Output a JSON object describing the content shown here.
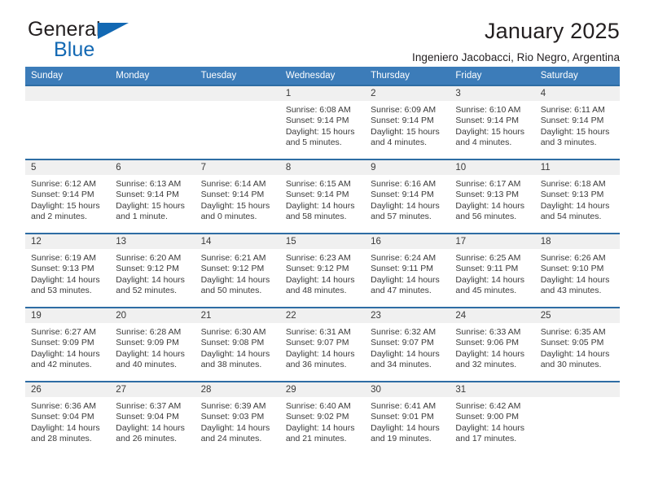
{
  "brand": {
    "line1": "General",
    "line2": "Blue",
    "triangle_color": "#1268b3"
  },
  "header": {
    "title": "January 2025",
    "subtitle": "Ingeniero Jacobacci, Rio Negro, Argentina",
    "accent_color": "#3c7cb9",
    "row_border_color": "#2e6da4",
    "daynum_bg": "#f0f0f0"
  },
  "weekday_headers": [
    "Sunday",
    "Monday",
    "Tuesday",
    "Wednesday",
    "Thursday",
    "Friday",
    "Saturday"
  ],
  "weeks": [
    [
      {
        "day": "",
        "empty": true
      },
      {
        "day": "",
        "empty": true
      },
      {
        "day": "",
        "empty": true
      },
      {
        "day": "1",
        "sunrise": "Sunrise: 6:08 AM",
        "sunset": "Sunset: 9:14 PM",
        "daylight": "Daylight: 15 hours and 5 minutes."
      },
      {
        "day": "2",
        "sunrise": "Sunrise: 6:09 AM",
        "sunset": "Sunset: 9:14 PM",
        "daylight": "Daylight: 15 hours and 4 minutes."
      },
      {
        "day": "3",
        "sunrise": "Sunrise: 6:10 AM",
        "sunset": "Sunset: 9:14 PM",
        "daylight": "Daylight: 15 hours and 4 minutes."
      },
      {
        "day": "4",
        "sunrise": "Sunrise: 6:11 AM",
        "sunset": "Sunset: 9:14 PM",
        "daylight": "Daylight: 15 hours and 3 minutes."
      }
    ],
    [
      {
        "day": "5",
        "sunrise": "Sunrise: 6:12 AM",
        "sunset": "Sunset: 9:14 PM",
        "daylight": "Daylight: 15 hours and 2 minutes."
      },
      {
        "day": "6",
        "sunrise": "Sunrise: 6:13 AM",
        "sunset": "Sunset: 9:14 PM",
        "daylight": "Daylight: 15 hours and 1 minute."
      },
      {
        "day": "7",
        "sunrise": "Sunrise: 6:14 AM",
        "sunset": "Sunset: 9:14 PM",
        "daylight": "Daylight: 15 hours and 0 minutes."
      },
      {
        "day": "8",
        "sunrise": "Sunrise: 6:15 AM",
        "sunset": "Sunset: 9:14 PM",
        "daylight": "Daylight: 14 hours and 58 minutes."
      },
      {
        "day": "9",
        "sunrise": "Sunrise: 6:16 AM",
        "sunset": "Sunset: 9:14 PM",
        "daylight": "Daylight: 14 hours and 57 minutes."
      },
      {
        "day": "10",
        "sunrise": "Sunrise: 6:17 AM",
        "sunset": "Sunset: 9:13 PM",
        "daylight": "Daylight: 14 hours and 56 minutes."
      },
      {
        "day": "11",
        "sunrise": "Sunrise: 6:18 AM",
        "sunset": "Sunset: 9:13 PM",
        "daylight": "Daylight: 14 hours and 54 minutes."
      }
    ],
    [
      {
        "day": "12",
        "sunrise": "Sunrise: 6:19 AM",
        "sunset": "Sunset: 9:13 PM",
        "daylight": "Daylight: 14 hours and 53 minutes."
      },
      {
        "day": "13",
        "sunrise": "Sunrise: 6:20 AM",
        "sunset": "Sunset: 9:12 PM",
        "daylight": "Daylight: 14 hours and 52 minutes."
      },
      {
        "day": "14",
        "sunrise": "Sunrise: 6:21 AM",
        "sunset": "Sunset: 9:12 PM",
        "daylight": "Daylight: 14 hours and 50 minutes."
      },
      {
        "day": "15",
        "sunrise": "Sunrise: 6:23 AM",
        "sunset": "Sunset: 9:12 PM",
        "daylight": "Daylight: 14 hours and 48 minutes."
      },
      {
        "day": "16",
        "sunrise": "Sunrise: 6:24 AM",
        "sunset": "Sunset: 9:11 PM",
        "daylight": "Daylight: 14 hours and 47 minutes."
      },
      {
        "day": "17",
        "sunrise": "Sunrise: 6:25 AM",
        "sunset": "Sunset: 9:11 PM",
        "daylight": "Daylight: 14 hours and 45 minutes."
      },
      {
        "day": "18",
        "sunrise": "Sunrise: 6:26 AM",
        "sunset": "Sunset: 9:10 PM",
        "daylight": "Daylight: 14 hours and 43 minutes."
      }
    ],
    [
      {
        "day": "19",
        "sunrise": "Sunrise: 6:27 AM",
        "sunset": "Sunset: 9:09 PM",
        "daylight": "Daylight: 14 hours and 42 minutes."
      },
      {
        "day": "20",
        "sunrise": "Sunrise: 6:28 AM",
        "sunset": "Sunset: 9:09 PM",
        "daylight": "Daylight: 14 hours and 40 minutes."
      },
      {
        "day": "21",
        "sunrise": "Sunrise: 6:30 AM",
        "sunset": "Sunset: 9:08 PM",
        "daylight": "Daylight: 14 hours and 38 minutes."
      },
      {
        "day": "22",
        "sunrise": "Sunrise: 6:31 AM",
        "sunset": "Sunset: 9:07 PM",
        "daylight": "Daylight: 14 hours and 36 minutes."
      },
      {
        "day": "23",
        "sunrise": "Sunrise: 6:32 AM",
        "sunset": "Sunset: 9:07 PM",
        "daylight": "Daylight: 14 hours and 34 minutes."
      },
      {
        "day": "24",
        "sunrise": "Sunrise: 6:33 AM",
        "sunset": "Sunset: 9:06 PM",
        "daylight": "Daylight: 14 hours and 32 minutes."
      },
      {
        "day": "25",
        "sunrise": "Sunrise: 6:35 AM",
        "sunset": "Sunset: 9:05 PM",
        "daylight": "Daylight: 14 hours and 30 minutes."
      }
    ],
    [
      {
        "day": "26",
        "sunrise": "Sunrise: 6:36 AM",
        "sunset": "Sunset: 9:04 PM",
        "daylight": "Daylight: 14 hours and 28 minutes."
      },
      {
        "day": "27",
        "sunrise": "Sunrise: 6:37 AM",
        "sunset": "Sunset: 9:04 PM",
        "daylight": "Daylight: 14 hours and 26 minutes."
      },
      {
        "day": "28",
        "sunrise": "Sunrise: 6:39 AM",
        "sunset": "Sunset: 9:03 PM",
        "daylight": "Daylight: 14 hours and 24 minutes."
      },
      {
        "day": "29",
        "sunrise": "Sunrise: 6:40 AM",
        "sunset": "Sunset: 9:02 PM",
        "daylight": "Daylight: 14 hours and 21 minutes."
      },
      {
        "day": "30",
        "sunrise": "Sunrise: 6:41 AM",
        "sunset": "Sunset: 9:01 PM",
        "daylight": "Daylight: 14 hours and 19 minutes."
      },
      {
        "day": "31",
        "sunrise": "Sunrise: 6:42 AM",
        "sunset": "Sunset: 9:00 PM",
        "daylight": "Daylight: 14 hours and 17 minutes."
      },
      {
        "day": "",
        "empty": true
      }
    ]
  ]
}
